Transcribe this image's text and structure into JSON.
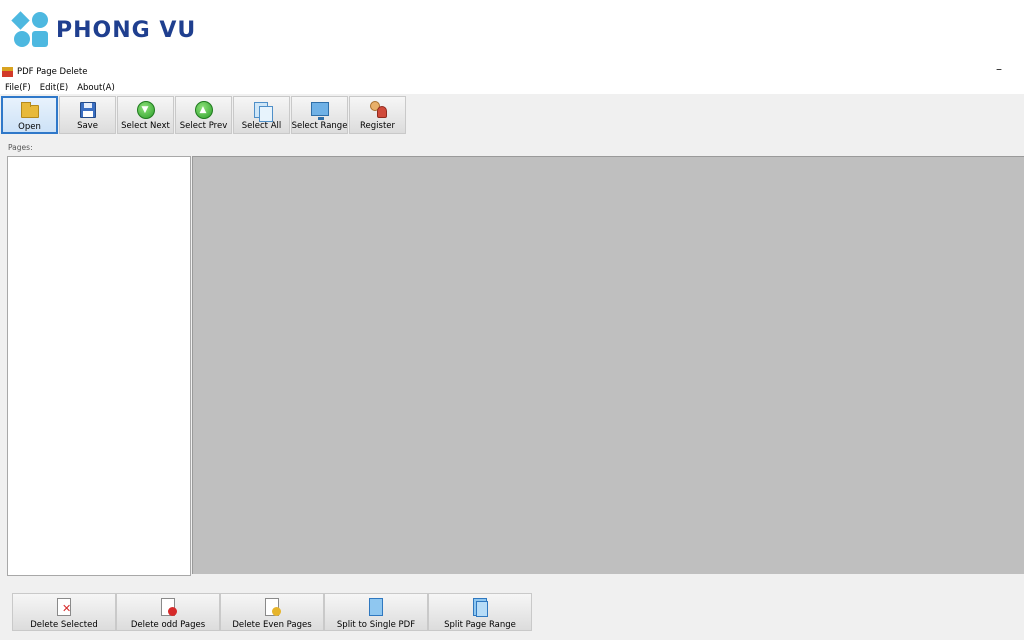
{
  "brand": {
    "name": "PHONG VU",
    "color": "#1f3f8f",
    "logo_color": "#4db8e0"
  },
  "window": {
    "title": "PDF Page Delete",
    "minimize_glyph": "–"
  },
  "menu": [
    {
      "label": "File(F)"
    },
    {
      "label": "Edit(E)"
    },
    {
      "label": "About(A)"
    }
  ],
  "toolbar": [
    {
      "label": "Open",
      "icon": "folder-open-icon",
      "active": true
    },
    {
      "label": "Save",
      "icon": "save-disk-icon"
    },
    {
      "label": "Select Next",
      "icon": "arrow-down-circle-icon"
    },
    {
      "label": "Select Prev",
      "icon": "arrow-up-circle-icon"
    },
    {
      "label": "Select All",
      "icon": "select-all-pages-icon"
    },
    {
      "label": "Select Range",
      "icon": "select-range-icon"
    },
    {
      "label": "Register",
      "icon": "register-users-icon"
    }
  ],
  "pages_label": "Pages:",
  "bottom_buttons": [
    {
      "label": "Delete Selected",
      "icon": "delete-selected-icon"
    },
    {
      "label": "Delete odd Pages",
      "icon": "delete-odd-icon"
    },
    {
      "label": "Delete Even Pages",
      "icon": "delete-even-icon"
    },
    {
      "label": "Split to Single PDF",
      "icon": "split-single-icon"
    },
    {
      "label": "Split Page Range",
      "icon": "split-range-icon"
    }
  ],
  "colors": {
    "preview_bg": "#bfbfbf",
    "active_border": "#2f78c9",
    "window_bg": "#f0f0f0"
  }
}
